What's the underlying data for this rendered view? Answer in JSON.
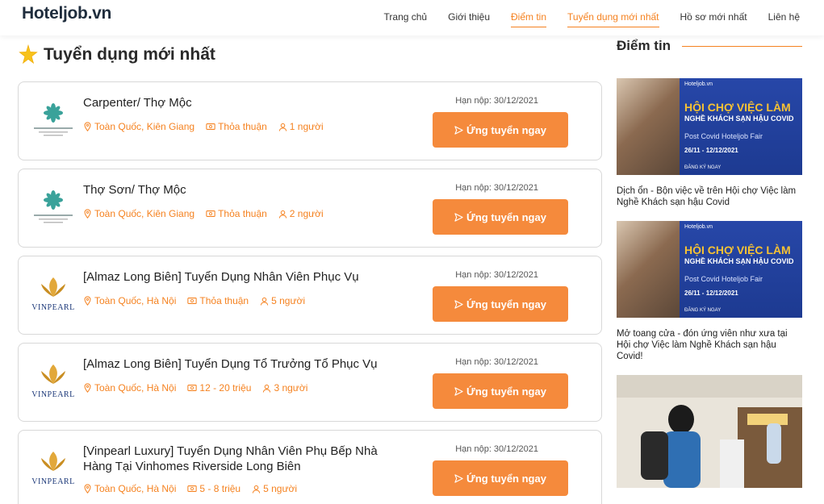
{
  "header": {
    "logo": "Hoteljob.vn",
    "nav": [
      {
        "label": "Trang chủ",
        "active": false
      },
      {
        "label": "Giới thiệu",
        "active": false
      },
      {
        "label": "Điểm tin",
        "active": true
      },
      {
        "label": "Tuyển dụng mới nhất",
        "active": true
      },
      {
        "label": "Hồ sơ mới nhất",
        "active": false
      },
      {
        "label": "Liên hệ",
        "active": false
      }
    ]
  },
  "main": {
    "title": "Tuyển dụng mới nhất",
    "icon": "star-icon",
    "jobs": [
      {
        "title": "Carpenter/ Thợ Mộc",
        "company_logo": "premier-residences-logo",
        "location": "Toàn Quốc, Kiên Giang",
        "salary": "Thỏa thuận",
        "headcount": "1 người",
        "deadline": "Hạn nộp: 30/12/2021",
        "apply_label": "Ứng tuyển ngay"
      },
      {
        "title": "Thợ Sơn/ Thợ Mộc",
        "company_logo": "premier-residences-logo",
        "location": "Toàn Quốc, Kiên Giang",
        "salary": "Thỏa thuận",
        "headcount": "2 người",
        "deadline": "Hạn nộp: 30/12/2021",
        "apply_label": "Ứng tuyển ngay"
      },
      {
        "title": "[Almaz Long Biên] Tuyển Dụng Nhân Viên Phục Vụ",
        "company_logo": "vinpearl-logo",
        "location": "Toàn Quốc, Hà Nội",
        "salary": "Thỏa thuận",
        "headcount": "5 người",
        "deadline": "Hạn nộp: 30/12/2021",
        "apply_label": "Ứng tuyển ngay"
      },
      {
        "title": "[Almaz Long Biên] Tuyển Dụng Tổ Trưởng Tổ Phục Vụ",
        "company_logo": "vinpearl-logo",
        "location": "Toàn Quốc, Hà Nội",
        "salary": "12 - 20 triệu",
        "headcount": "3 người",
        "deadline": "Hạn nộp: 30/12/2021",
        "apply_label": "Ứng tuyển ngay"
      },
      {
        "title": "[Vinpearl Luxury] Tuyển Dụng Nhân Viên Phụ Bếp Nhà Hàng Tại Vinhomes Riverside Long Biên",
        "company_logo": "vinpearl-logo",
        "location": "Toàn Quốc, Hà Nội",
        "salary": "5 - 8 triệu",
        "headcount": "5 người",
        "deadline": "Hạn nộp: 30/12/2021",
        "apply_label": "Ứng tuyển ngay"
      }
    ]
  },
  "sidebar": {
    "title": "Điểm tin",
    "banner": {
      "brand": "Hoteljob.vn",
      "headline": "HỘI CHỢ VIỆC LÀM",
      "subheadline": "NGHỀ KHÁCH SẠN HẬU COVID",
      "event": "Post Covid Hoteljob Fair",
      "dates": "26/11 - 12/12/2021",
      "cta": "ĐĂNG KÝ NGAY"
    },
    "news": [
      {
        "text": "Dịch ổn - Bộn việc về trên Hội chợ Việc làm Nghề Khách sạn hậu Covid"
      },
      {
        "text": "Mở toang cửa - đón ứng viên như xưa tại Hội chợ Việc làm Nghề Khách sạn hậu Covid!"
      }
    ]
  },
  "colors": {
    "accent": "#f58220",
    "button": "#f58a3c",
    "banner_blue": "#2747a8"
  }
}
